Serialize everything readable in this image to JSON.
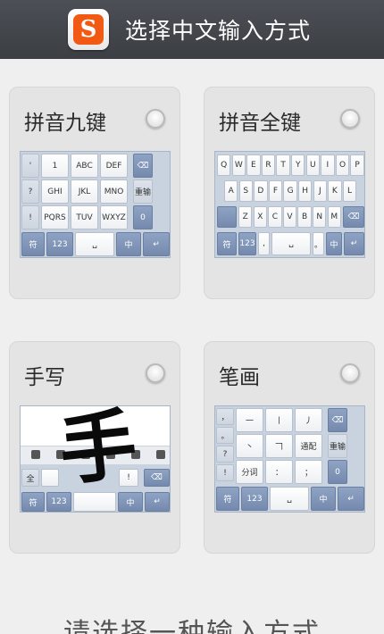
{
  "header": {
    "title": "选择中文输入方式",
    "app_icon": "sogou-icon",
    "app_icon_letter": "S"
  },
  "cards": {
    "t9": {
      "title": "拼音九键"
    },
    "qwerty": {
      "title": "拼音全键"
    },
    "handwrite": {
      "title": "手写",
      "sample_char": "手"
    },
    "stroke": {
      "title": "笔画"
    }
  },
  "t9_keys": {
    "left": [
      "'",
      "?",
      "!"
    ],
    "digits": [
      "1",
      "ABC",
      "DEF",
      "GHI",
      "JKL",
      "MNO",
      "PQRS",
      "TUV",
      "WXYZ"
    ],
    "right": [
      "⌫",
      "重输",
      "0",
      "↵"
    ],
    "bottom": [
      "符",
      "123",
      "␣",
      "中"
    ]
  },
  "qwerty_keys": {
    "row1": [
      "Q",
      "W",
      "E",
      "R",
      "T",
      "Y",
      "U",
      "I",
      "O",
      "P"
    ],
    "row2": [
      "A",
      "S",
      "D",
      "F",
      "G",
      "H",
      "J",
      "K",
      "L"
    ],
    "row3": [
      "Z",
      "X",
      "C",
      "V",
      "B",
      "N",
      "M"
    ],
    "bottom": [
      "符",
      "123",
      ",",
      "␣",
      "。",
      "中",
      "↵"
    ]
  },
  "hw_keys": {
    "labels": [
      "全",
      "符",
      "123",
      "中"
    ]
  },
  "stroke_keys": {
    "left": [
      "，",
      "。",
      "?",
      "!"
    ],
    "strokes": [
      "一",
      "丨",
      "丿",
      "丶",
      "𠃍",
      "通配",
      "分词",
      "：",
      "；"
    ],
    "right": [
      "⌫",
      "重输",
      "0",
      "↵"
    ],
    "bottom": [
      "符",
      "123",
      "␣",
      "中"
    ]
  },
  "footer": {
    "prompt": "请选择一种输入方式"
  }
}
